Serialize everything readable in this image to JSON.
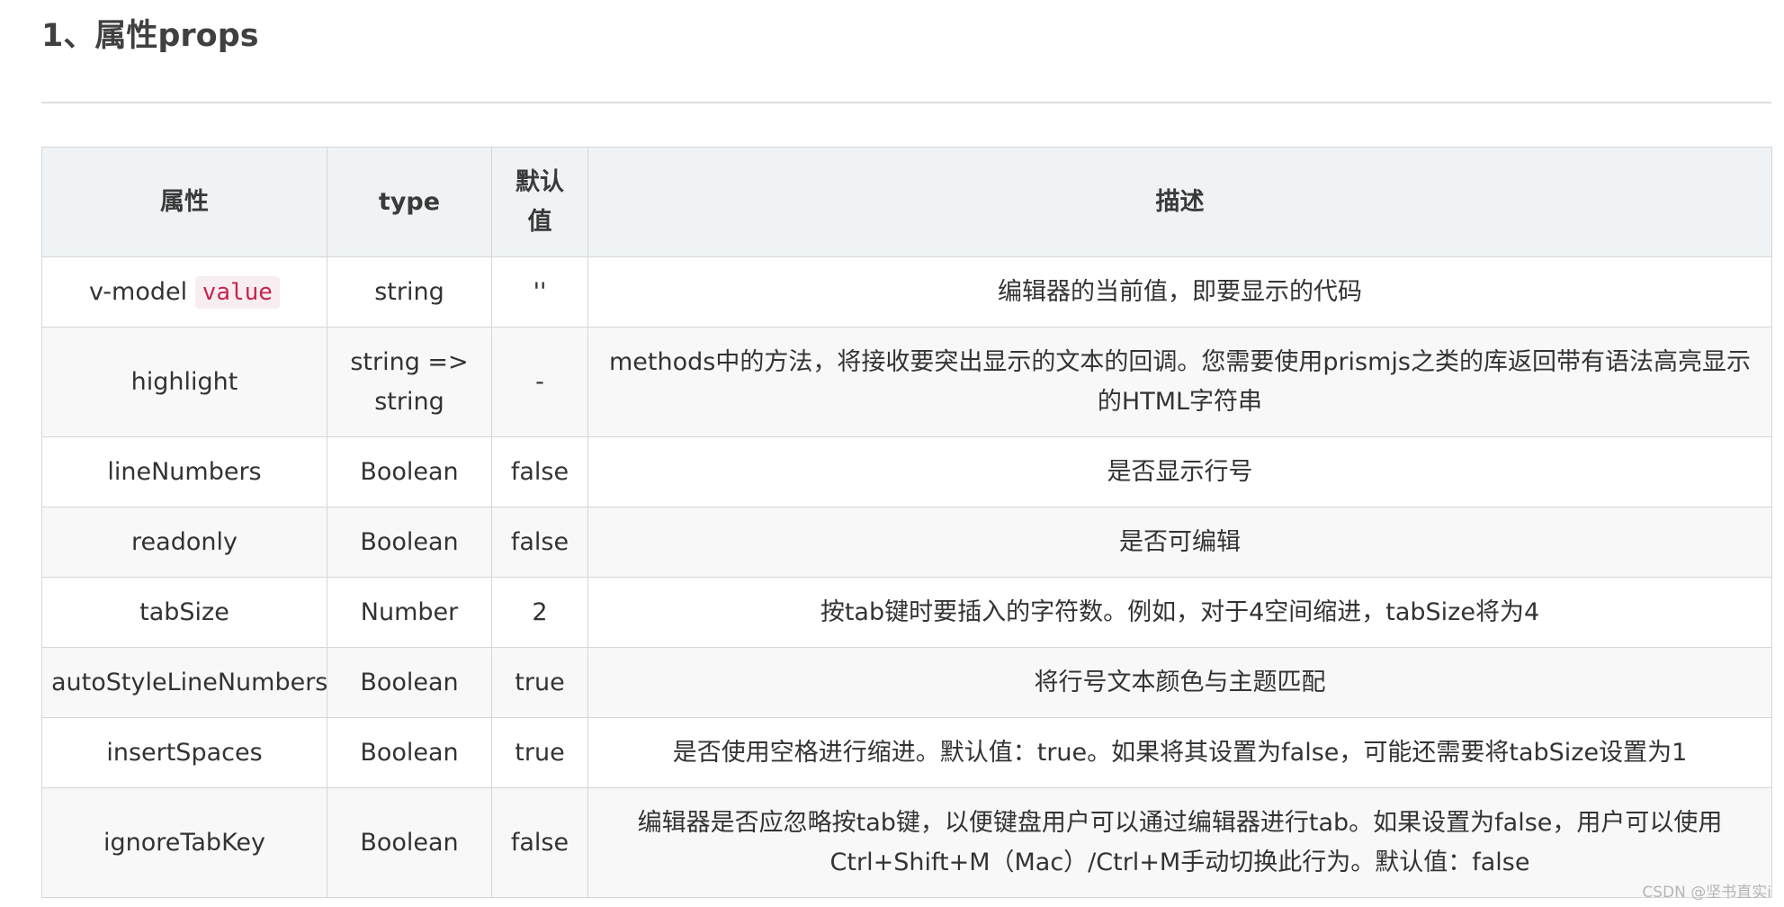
{
  "heading": "1、属性props",
  "table": {
    "headers": [
      "属性",
      "type",
      "默认值",
      "描述"
    ],
    "rows": [
      {
        "prop": "v-model",
        "prop_code": "value",
        "type": "string",
        "default": "''",
        "desc": "编辑器的当前值，即要显示的代码"
      },
      {
        "prop": "highlight",
        "type": "string => string",
        "default": "-",
        "desc": "methods中的方法，将接收要突出显示的文本的回调。您需要使用prismjs之类的库返回带有语法高亮显示的HTML字符串"
      },
      {
        "prop": "lineNumbers",
        "type": "Boolean",
        "default": "false",
        "desc": "是否显示行号"
      },
      {
        "prop": "readonly",
        "type": "Boolean",
        "default": "false",
        "desc": "是否可编辑"
      },
      {
        "prop": "tabSize",
        "type": "Number",
        "default": "2",
        "desc": "按tab键时要插入的字符数。例如，对于4空间缩进，tabSize将为4"
      },
      {
        "prop": "autoStyleLineNumbers",
        "type": "Boolean",
        "default": "true",
        "desc": "将行号文本颜色与主题匹配"
      },
      {
        "prop": "insertSpaces",
        "type": "Boolean",
        "default": "true",
        "desc": "是否使用空格进行缩进。默认值：true。如果将其设置为false，可能还需要将tabSize设置为1"
      },
      {
        "prop": "ignoreTabKey",
        "type": "Boolean",
        "default": "false",
        "desc": "编辑器是否应忽略按tab键，以便键盘用户可以通过编辑器进行tab。如果设置为false，用户可以使用Ctrl+Shift+M（Mac）/Ctrl+M手动切换此行为。默认值：false"
      }
    ]
  },
  "watermark": "CSDN @坚书直实i"
}
